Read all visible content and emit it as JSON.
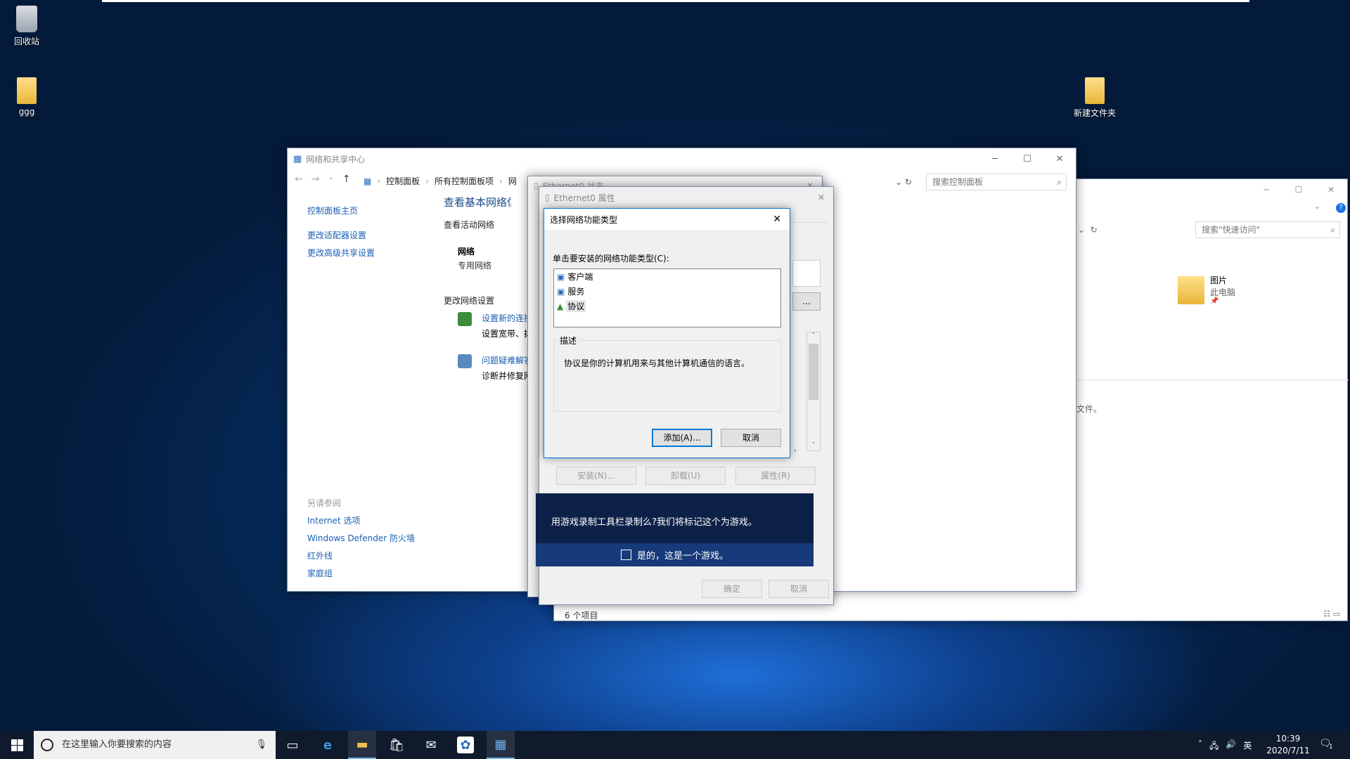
{
  "desktop": {
    "icons": [
      {
        "label": "回收站",
        "icon": "recycle-bin-icon"
      },
      {
        "label": "ggg",
        "icon": "user-folder-icon"
      },
      {
        "label": "新建文件夹",
        "icon": "folder-icon"
      }
    ]
  },
  "network_center": {
    "title": "网络和共享中心",
    "breadcrumb": [
      "控制面板",
      "所有控制面板项",
      "网"
    ],
    "search_placeholder": "搜索控制面板",
    "sidebar": {
      "home": "控制面板主页",
      "items": [
        "更改适配器设置",
        "更改高级共享设置"
      ],
      "see_also_header": "另请参阅",
      "see_also": [
        "Internet 选项",
        "Windows Defender 防火墙",
        "红外线",
        "家庭组"
      ]
    },
    "main": {
      "heading": "查看基本网络信息",
      "active_networks": "查看活动网络",
      "network_name": "网络",
      "network_type": "专用网络",
      "change_settings": "更改网络设置",
      "task1_link": "设置新的连接",
      "task1_desc": "设置宽带、拨",
      "task2_link": "问题疑难解答",
      "task2_desc": "诊断并修复网"
    }
  },
  "explorer": {
    "search_placeholder": "搜索\"快速访问\"",
    "item_name": "图片",
    "item_sub": "此电脑",
    "files_text": "文件。",
    "status": "6 个项目"
  },
  "status_window": {
    "title": "Ethernet0 状态"
  },
  "props_window": {
    "title": "Ethernet0 属性",
    "install": "安装(N)...",
    "uninstall": "卸载(U)",
    "properties": "属性(R)",
    "ok": "确定",
    "cancel": "取消"
  },
  "dialog": {
    "title": "选择网络功能类型",
    "prompt": "单击要安装的网络功能类型(C):",
    "items": [
      "客户端",
      "服务",
      "协议"
    ],
    "desc_header": "描述",
    "desc": "协议是你的计算机用来与其他计算机通信的语言。",
    "add": "添加(A)...",
    "cancel": "取消"
  },
  "game_bar": {
    "question": "用游戏录制工具栏录制么?我们将标记这个为游戏。",
    "checkbox_label": "是的，这是一个游戏。"
  },
  "taskbar": {
    "search_placeholder": "在这里输入你要搜索的内容",
    "ime": "英",
    "time": "10:39",
    "date": "2020/7/11",
    "notification_count": "1"
  }
}
